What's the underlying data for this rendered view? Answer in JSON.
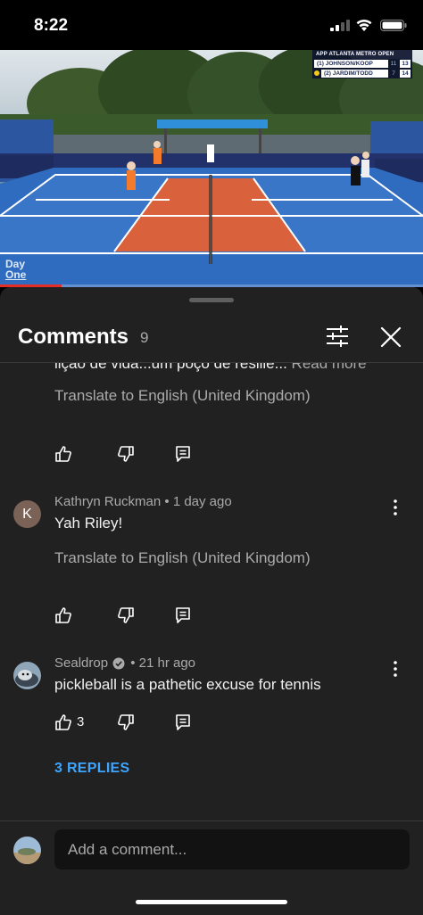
{
  "status_bar": {
    "time": "8:22"
  },
  "video": {
    "scoreboard": {
      "title": "APP ATLANTA METRO OPEN",
      "rows": [
        {
          "team": "(1) JOHNSON/KOOP",
          "game1": "11",
          "game2": "13"
        },
        {
          "team": "(2) JARDIM/TODD",
          "game1": "7",
          "game2": "14"
        }
      ]
    },
    "brand_logo_line1": "Day",
    "brand_logo_line2": "One",
    "progress_fraction": 0.145,
    "court_colors": {
      "court": "#d9613c",
      "surround": "#2f6cbf",
      "sky": "#c9d6df"
    }
  },
  "comments_panel": {
    "title": "Comments",
    "count": "9",
    "filter_icon": "sliders-icon",
    "close_icon": "close-icon",
    "partial_comment": {
      "text": "lição de vida...um poço de resilie...",
      "read_more": " Read more",
      "translate": "Translate to English (United Kingdom)"
    },
    "comments": [
      {
        "author": "Kathryn Ruckman",
        "separator": " • ",
        "time": "1 day ago",
        "avatar_letter": "K",
        "text": "Yah Riley!",
        "translate": "Translate to English (United Kingdom)",
        "likes": ""
      },
      {
        "author": "Sealdrop",
        "separator": " • ",
        "time": "21 hr ago",
        "verified": true,
        "text": "pickleball is a pathetic excuse for tennis",
        "likes": "3",
        "replies": "3 REPLIES"
      }
    ],
    "input_placeholder": "Add a comment..."
  },
  "colors": {
    "sheet_bg": "#212121",
    "accent_link": "#3ea6ff",
    "progress": "#e52d27"
  }
}
